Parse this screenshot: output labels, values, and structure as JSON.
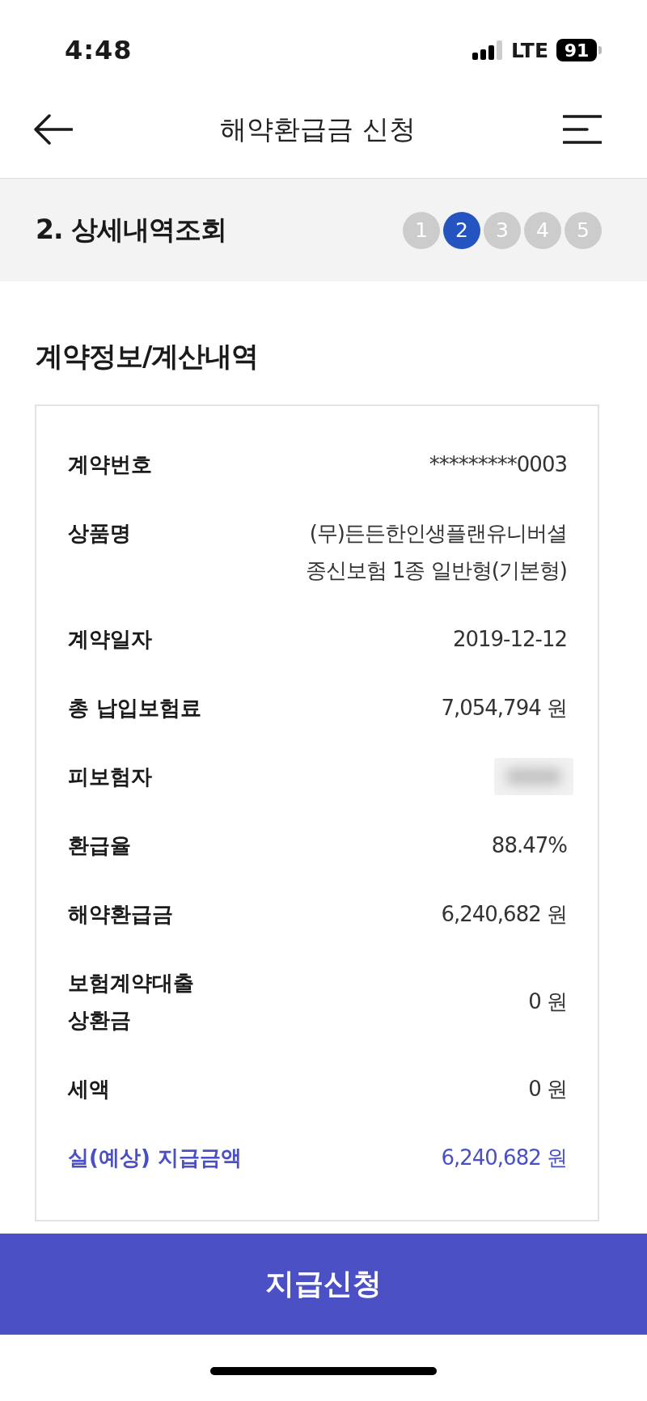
{
  "status_bar": {
    "time": "4:48",
    "network": "LTE",
    "battery": "91"
  },
  "header": {
    "title": "해약환급금 신청"
  },
  "step_bar": {
    "title": "2. 상세내역조회",
    "steps": [
      {
        "label": "1",
        "selected": false
      },
      {
        "label": "2",
        "selected": true
      },
      {
        "label": "3",
        "selected": false
      },
      {
        "label": "4",
        "selected": false
      },
      {
        "label": "5",
        "selected": false
      }
    ]
  },
  "section": {
    "title": "계약정보/계산내역",
    "rows": [
      {
        "kind": "plain",
        "label": "계약번호",
        "value": "*********0003"
      },
      {
        "kind": "plain",
        "label": "상품명",
        "value": "(무)든든한인생플랜유니버셜\n종신보험 1종 일반형(기본형)"
      },
      {
        "kind": "plain",
        "label": "계약일자",
        "value": "2019-12-12"
      },
      {
        "kind": "plain",
        "label": "총 납입보험료",
        "value": "7,054,794 원"
      },
      {
        "kind": "redacted",
        "label": "피보험자"
      },
      {
        "kind": "plain",
        "label": "환급율",
        "value": "88.47%"
      },
      {
        "kind": "plain",
        "label": "해약환급금",
        "value": "6,240,682 원"
      },
      {
        "kind": "plain",
        "label": "보험계약대출\n상환금",
        "value": "0 원"
      },
      {
        "kind": "plain",
        "label": "세액",
        "value": "0 원"
      },
      {
        "kind": "highlight",
        "label": "실(예상) 지급금액",
        "value": "6,240,682 원"
      }
    ]
  },
  "submit_button": {
    "label": "지급신청"
  }
}
